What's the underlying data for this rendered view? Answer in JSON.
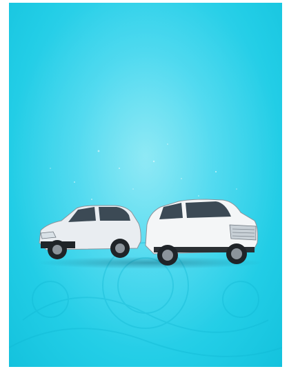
{
  "banner": {
    "background_color": "#22cde6",
    "accent_color": "#6fe3f3",
    "footer_text": ""
  },
  "cars": [
    {
      "icon": "hatchback-car-icon",
      "color": "#e9edf1"
    },
    {
      "icon": "suv-car-icon",
      "color": "#f4f6f7"
    }
  ]
}
